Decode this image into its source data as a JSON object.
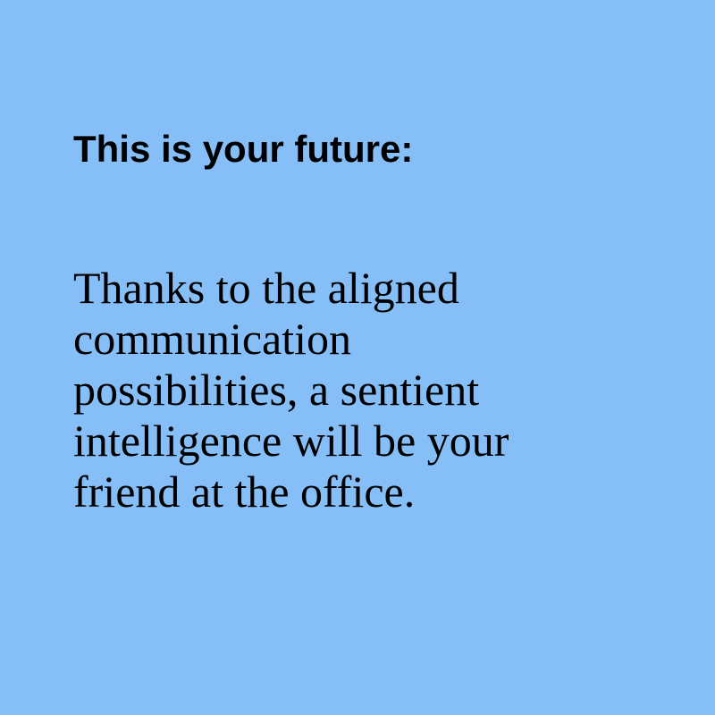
{
  "theme": {
    "background_color": "#86bff8",
    "text_color": "#000000"
  },
  "card": {
    "heading": "This is your future:",
    "body_lines": [
      "Thanks to the aligned",
      "communication",
      "possibilities, a sentient",
      "intelligence will be your",
      "friend at the office."
    ]
  }
}
